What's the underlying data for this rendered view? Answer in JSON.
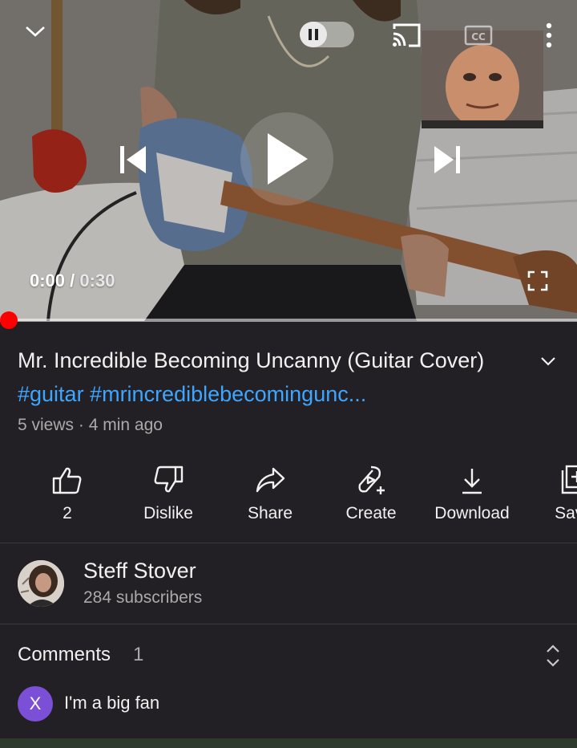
{
  "player": {
    "current_time": "0:00",
    "separator": " / ",
    "duration": "0:30",
    "progress_fraction": 0.0,
    "icons": [
      "chevron-down-icon",
      "pause-icon",
      "cast-icon",
      "closed-captions-icon",
      "more-vert-icon",
      "skip-previous-icon",
      "play-icon",
      "skip-next-icon",
      "fullscreen-icon"
    ]
  },
  "video": {
    "title": "Mr. Incredible Becoming Uncanny (Guitar Cover)",
    "hashtags": "#guitar #mrincrediblebecomingunc...",
    "views": "5 views",
    "dot": " · ",
    "age": "4 min ago"
  },
  "actions": [
    {
      "label": "2",
      "icon": "thumbs-up-icon"
    },
    {
      "label": "Dislike",
      "icon": "thumbs-down-icon"
    },
    {
      "label": "Share",
      "icon": "share-icon"
    },
    {
      "label": "Create",
      "icon": "create-icon"
    },
    {
      "label": "Download",
      "icon": "download-icon"
    },
    {
      "label": "Save",
      "icon": "save-playlist-icon"
    }
  ],
  "channel": {
    "name": "Steff Stover",
    "subscribers": "284 subscribers"
  },
  "comments": {
    "header": "Comments",
    "count": "1",
    "first_comment": {
      "avatar_letter": "X",
      "avatar_color": "#7b4fd6",
      "text": "I'm a big fan"
    }
  },
  "colors": {
    "background": "#222024",
    "accent_link": "#3ea6ff",
    "progress": "#ff0000"
  }
}
